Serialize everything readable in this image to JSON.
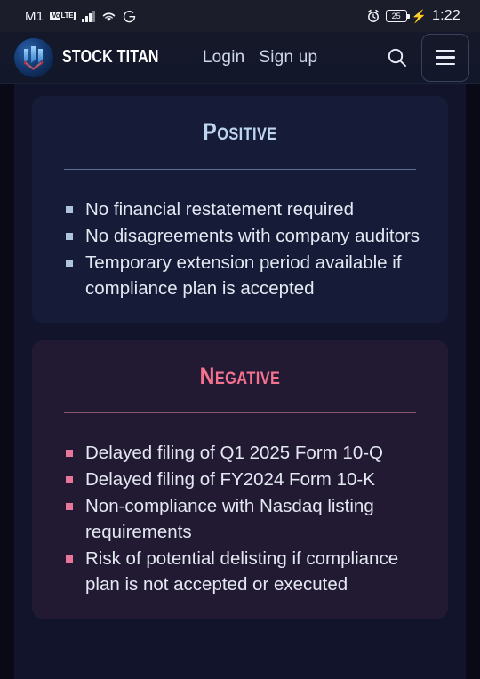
{
  "status_bar": {
    "carrier": "M1",
    "volte_badge": "VoLTE",
    "network_icon": "signal-bars-icon",
    "wifi_icon": "wifi-icon",
    "google_icon": "google-g-icon",
    "alarm_icon": "alarm-clock-icon",
    "battery_level": "25",
    "charging_icon": "lightning-bolt-icon",
    "time": "1:22"
  },
  "header": {
    "logo_icon": "stock-titan-logo-icon",
    "brand_name": "STOCK TITAN",
    "links": [
      {
        "label": "Login",
        "name": "login-link"
      },
      {
        "label": "Sign up",
        "name": "signup-link"
      }
    ],
    "search_icon": "search-icon",
    "menu_icon": "hamburger-menu-icon"
  },
  "cards": [
    {
      "name": "positive-card",
      "title": "Positive",
      "accent_color": "#bcd6f2",
      "bullet_color": "#aec4de",
      "background": "#161b38",
      "points": [
        "No financial restatement required",
        "No disagreements with company auditors",
        "Temporary extension period available if compliance plan is accepted"
      ]
    },
    {
      "name": "negative-card",
      "title": "Negative",
      "accent_color": "#f4718f",
      "bullet_color": "#e8769b",
      "background": "#221a33",
      "points": [
        "Delayed filing of Q1 2025 Form 10-Q",
        "Delayed filing of FY2024 Form 10-K",
        "Non-compliance with Nasdaq listing requirements",
        "Risk of potential delisting if compliance plan is not accepted or executed"
      ]
    }
  ]
}
